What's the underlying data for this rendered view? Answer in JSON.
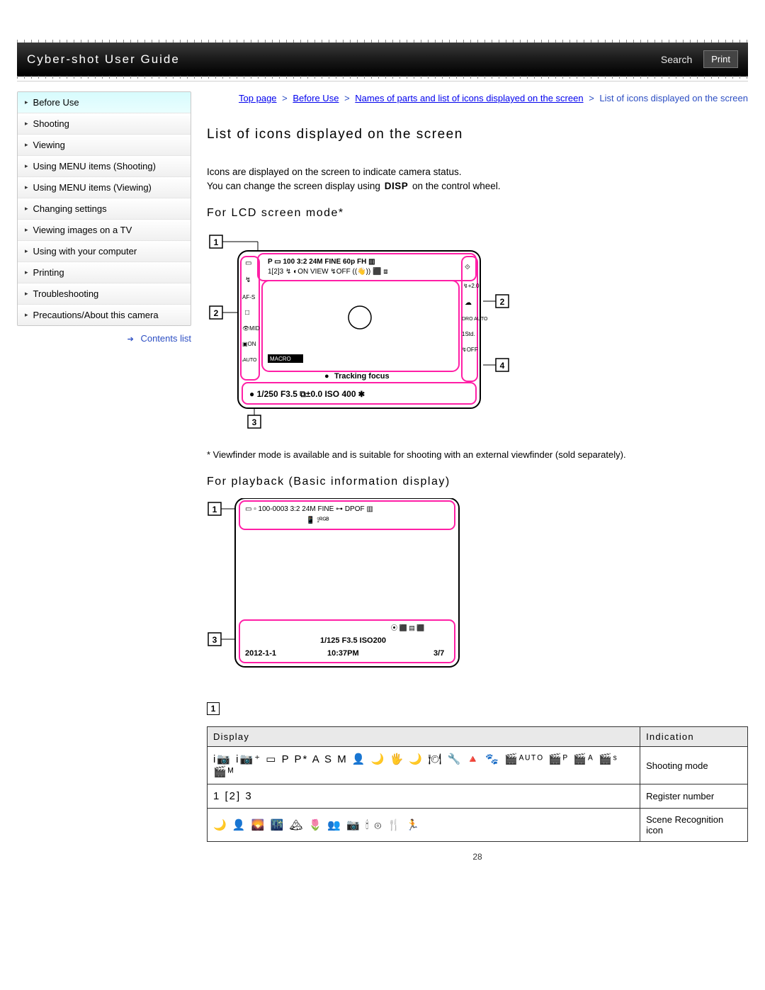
{
  "header": {
    "title": "Cyber-shot User Guide",
    "search": "Search",
    "print": "Print"
  },
  "sidebar": {
    "items": [
      {
        "label": "Before Use",
        "active": true
      },
      {
        "label": "Shooting"
      },
      {
        "label": "Viewing"
      },
      {
        "label": "Using MENU items (Shooting)"
      },
      {
        "label": "Using MENU items (Viewing)"
      },
      {
        "label": "Changing settings"
      },
      {
        "label": "Viewing images on a TV"
      },
      {
        "label": "Using with your computer"
      },
      {
        "label": "Printing"
      },
      {
        "label": "Troubleshooting"
      },
      {
        "label": "Precautions/About this camera"
      }
    ],
    "contents_link": "Contents list"
  },
  "breadcrumb": {
    "parts": [
      "Top page",
      "Before Use",
      "Names of parts and list of icons displayed on the screen",
      "List of icons displayed on the screen"
    ]
  },
  "main": {
    "title": "List of icons displayed on the screen",
    "intro1": "Icons are displayed on the screen to indicate camera status.",
    "intro2a": "You can change the screen display using",
    "disp_label": "DISP",
    "intro2b": "on the control wheel.",
    "section_lcd": "For LCD screen mode*",
    "footnote": "* Viewfinder mode is available and is suitable for shooting with an external viewfinder (sold separately).",
    "section_playback": "For playback (Basic information display)",
    "callout_1": "1",
    "callout_2": "2",
    "callout_3": "3",
    "callout_4": "4",
    "table": {
      "head_display": "Display",
      "head_indication": "Indication",
      "rows": [
        {
          "display_icons": "i📷 i📷⁺ ▭ P P* A S M 👤 🌙 🖐 🌙 🍽 🔧 🔺 🐾 🎬ᴬᵁᵀᴼ 🎬ᴾ 🎬ᴬ 🎬ˢ 🎬ᴹ",
          "indication": "Shooting mode"
        },
        {
          "display_icons": "1 [2] 3",
          "indication": "Register number"
        },
        {
          "display_icons": "🌙 👤 🌄 🌃 🏔 🌷 👥 📷 🕯 ⊚ 🍴 🏃",
          "indication": "Scene Recognition icon"
        }
      ]
    }
  },
  "lcd_overlay": {
    "top_row": "P  ▭ 100 3:2 24M FINE 60p FH ▥",
    "top_row2": "1[2]3  ↯ ◐ON VIEW  ↯OFF ((👋)) ⬛ ⧈",
    "left_icons": [
      "▭",
      "↯",
      "AF-S",
      "□",
      "👁MID",
      "▣ON",
      "ᵢAUTO"
    ],
    "right_icons": [
      "⟐",
      "↯+2.0",
      "☁",
      "DRO AUTO",
      "1Std.",
      "↯OFF"
    ],
    "center_text": "Tracking focus",
    "macro": "MACRO",
    "bottom_row": "● 1/250   F3.5  ⧉±0.0  ISO 400   ✱"
  },
  "playback_overlay": {
    "top_row": "▭ ▫ 100-0003   3:2 24M  FINE  ⊶ DPOF ▥",
    "top_row2": "📱  ⟟ᴿᴳᴮ",
    "mid": "⦿ ⬛ ▤ ⬛",
    "line1": "1/125   F3.5   ISO200",
    "line2a": "2012-1-1",
    "line2b": "10:37PM",
    "line2c": "3/7"
  },
  "page_number": "28"
}
